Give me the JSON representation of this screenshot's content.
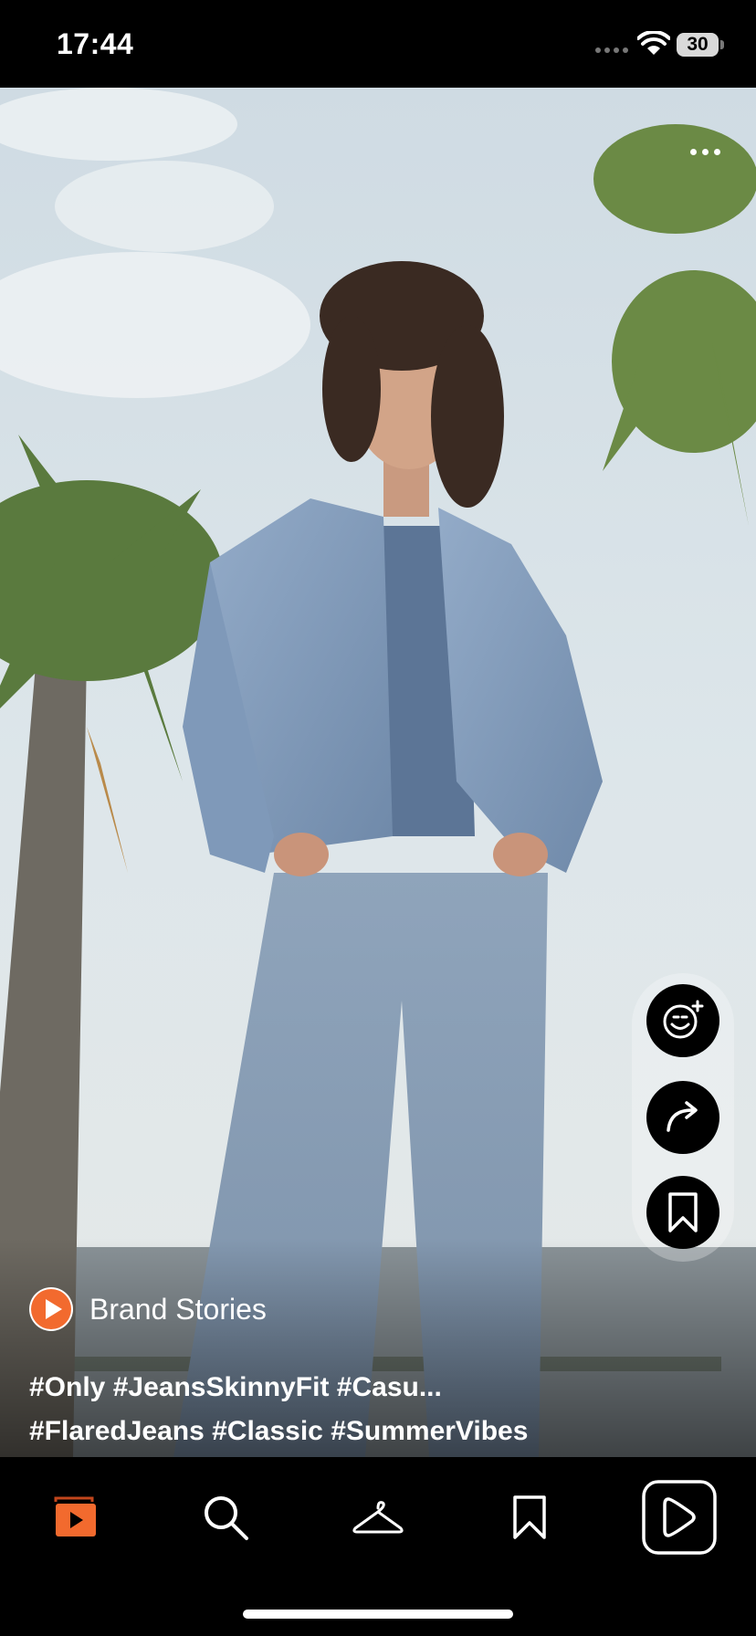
{
  "status_bar": {
    "time": "17:44",
    "battery": "30"
  },
  "brand": {
    "name": "Brand Stories"
  },
  "hashtags": {
    "line1": "#Only #JeansSkinnyFit #Casu...",
    "line2": "#FlaredJeans #Classic #SummerVibes"
  },
  "colors": {
    "accent": "#f26a2e",
    "rail": "rgba(255,255,255,0.28)"
  },
  "icons": {
    "more": "more-horizontal-icon",
    "react": "add-reaction-icon",
    "share": "share-arrow-icon",
    "save": "bookmark-icon",
    "nav": [
      "video-feed-icon",
      "search-icon",
      "hanger-icon",
      "bookmark-icon",
      "play-icon"
    ]
  }
}
